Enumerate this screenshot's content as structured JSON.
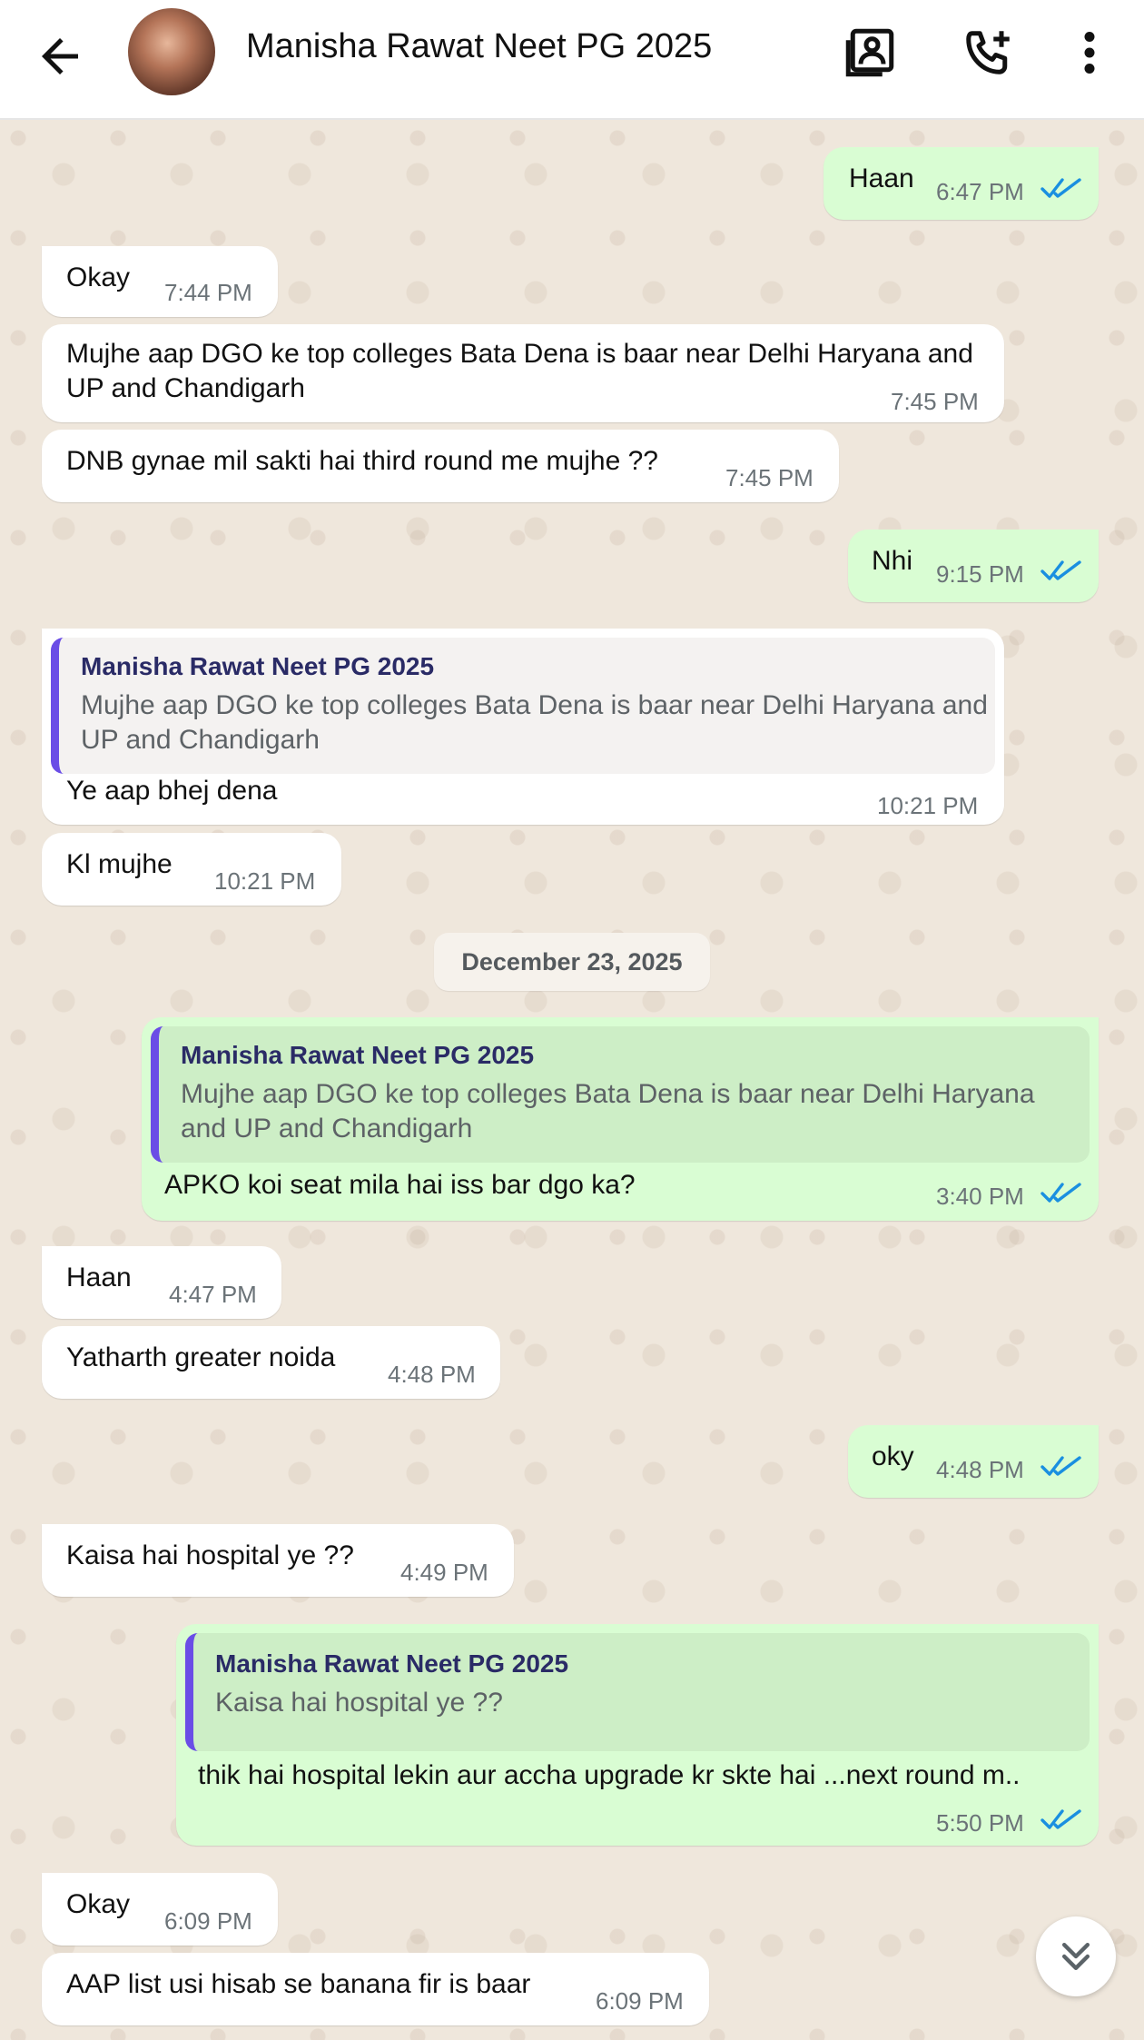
{
  "header": {
    "title": "Manisha Rawat Neet PG 2025",
    "icons": [
      "back-arrow-icon",
      "contact-card-icon",
      "add-call-icon",
      "more-vert-icon"
    ]
  },
  "messages": [
    {
      "dir": "out",
      "text": "Haan",
      "time": "6:47 PM",
      "status": "read"
    },
    {
      "dir": "in",
      "text": "Okay",
      "time": "7:44 PM"
    },
    {
      "dir": "in",
      "text": "Mujhe aap DGO ke top colleges Bata Dena is baar near Delhi Haryana and UP and Chandigarh",
      "time": "7:45 PM"
    },
    {
      "dir": "in",
      "text": "DNB gynae mil sakti hai third round me mujhe ??",
      "time": "7:45 PM"
    },
    {
      "dir": "out",
      "text": "Nhi",
      "time": "9:15 PM",
      "status": "read"
    },
    {
      "dir": "in",
      "quote_author": "Manisha Rawat Neet PG 2025",
      "quote_text": "Mujhe aap DGO ke top colleges Bata Dena is baar near Delhi Haryana and UP and Chandigarh",
      "text": "Ye aap bhej dena",
      "time": "10:21 PM"
    },
    {
      "dir": "in",
      "text": "Kl mujhe",
      "time": "10:21 PM"
    },
    {
      "dir": "out",
      "quote_author": "Manisha Rawat Neet PG 2025",
      "quote_text": "Mujhe aap DGO ke top colleges Bata Dena is baar near Delhi Haryana and UP and Chandigarh",
      "text": "APKO koi seat mila hai iss bar dgo ka?",
      "time": "3:40 PM",
      "status": "read"
    },
    {
      "dir": "in",
      "text": "Haan",
      "time": "4:47 PM"
    },
    {
      "dir": "in",
      "text": "Yatharth greater noida",
      "time": "4:48 PM"
    },
    {
      "dir": "out",
      "text": "oky",
      "time": "4:48 PM",
      "status": "read"
    },
    {
      "dir": "in",
      "text": "Kaisa hai hospital ye ??",
      "time": "4:49 PM"
    },
    {
      "dir": "out",
      "quote_author": "Manisha Rawat Neet PG 2025",
      "quote_text": "Kaisa hai hospital ye ??",
      "text": "thik hai hospital lekin aur accha upgrade kr skte hai ...next round m..",
      "time": "5:50 PM",
      "status": "read"
    },
    {
      "dir": "in",
      "text": "Okay",
      "time": "6:09 PM"
    },
    {
      "dir": "in",
      "text": "AAP list usi hisab se banana fir is baar",
      "time": "6:09 PM"
    }
  ],
  "date_separator": "December 23, 2025",
  "colors": {
    "outgoing_bubble": "#d9fdd3",
    "incoming_bubble": "#ffffff",
    "read_ticks": "#1a8fe0",
    "quote_bar": "#6a4de6"
  },
  "scroll_button_icon": "double-chevron-down-icon"
}
